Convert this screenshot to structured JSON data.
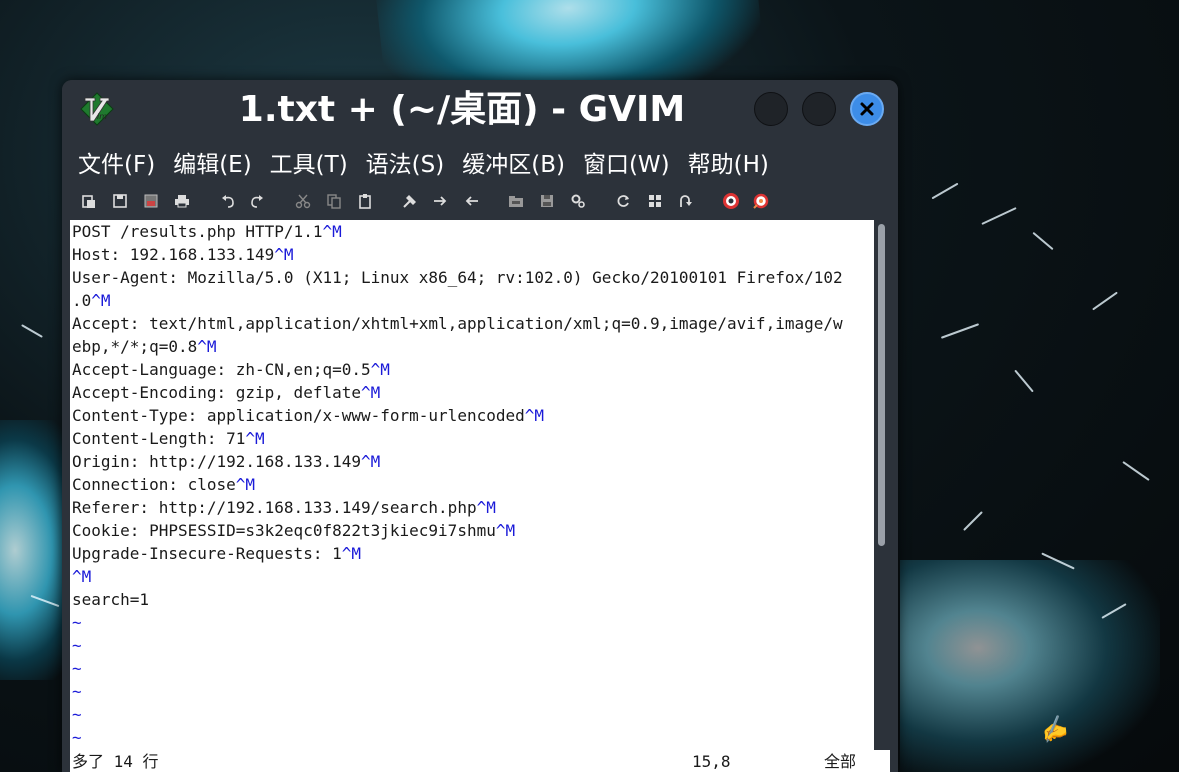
{
  "window": {
    "title": "1.txt + (~/桌面) - GVIM",
    "controls": [
      "minimize",
      "maximize",
      "close"
    ]
  },
  "menubar": {
    "items": [
      {
        "label": "文件(F)"
      },
      {
        "label": "编辑(E)"
      },
      {
        "label": "工具(T)"
      },
      {
        "label": "语法(S)"
      },
      {
        "label": "缓冲区(B)"
      },
      {
        "label": "窗口(W)"
      },
      {
        "label": "帮助(H)"
      }
    ]
  },
  "toolbar": {
    "buttons": [
      {
        "icon": "open-file-icon"
      },
      {
        "icon": "save-icon"
      },
      {
        "icon": "save-all-icon"
      },
      {
        "icon": "print-icon"
      },
      {
        "icon": "undo-icon"
      },
      {
        "icon": "redo-icon"
      },
      {
        "icon": "cut-icon"
      },
      {
        "icon": "copy-icon"
      },
      {
        "icon": "paste-icon"
      },
      {
        "icon": "replace-icon"
      },
      {
        "icon": "find-next-icon"
      },
      {
        "icon": "find-previous-icon"
      },
      {
        "icon": "load-session-icon"
      },
      {
        "icon": "save-session-icon"
      },
      {
        "icon": "run-script-icon"
      },
      {
        "icon": "make-icon"
      },
      {
        "icon": "run-ctags-icon"
      },
      {
        "icon": "jump-tag-icon"
      },
      {
        "icon": "help-icon"
      },
      {
        "icon": "find-help-icon"
      }
    ]
  },
  "editor": {
    "lines": [
      {
        "text": "POST /results.php HTTP/1.1",
        "cr": "^M"
      },
      {
        "text": "Host: 192.168.133.149",
        "cr": "^M"
      },
      {
        "text": "User-Agent: Mozilla/5.0 (X11; Linux x86_64; rv:102.0) Gecko/20100101 Firefox/102",
        "cr": ""
      },
      {
        "text": ".0",
        "cr": "^M"
      },
      {
        "text": "Accept: text/html,application/xhtml+xml,application/xml;q=0.9,image/avif,image/w",
        "cr": ""
      },
      {
        "text": "ebp,*/*;q=0.8",
        "cr": "^M"
      },
      {
        "text": "Accept-Language: zh-CN,en;q=0.5",
        "cr": "^M"
      },
      {
        "text": "Accept-Encoding: gzip, deflate",
        "cr": "^M"
      },
      {
        "text": "Content-Type: application/x-www-form-urlencoded",
        "cr": "^M"
      },
      {
        "text": "Content-Length: 71",
        "cr": "^M"
      },
      {
        "text": "Origin: http://192.168.133.149",
        "cr": "^M"
      },
      {
        "text": "Connection: close",
        "cr": "^M"
      },
      {
        "text": "Referer: http://192.168.133.149/search.php",
        "cr": "^M"
      },
      {
        "text": "Cookie: PHPSESSID=s3k2eqc0f822t3jkiec9i7shmu",
        "cr": "^M"
      },
      {
        "text": "Upgrade-Insecure-Requests: 1",
        "cr": "^M"
      },
      {
        "text": "",
        "cr": "^M"
      },
      {
        "text": "search=1",
        "cr": ""
      }
    ],
    "filler": "~",
    "filler_count": 6
  },
  "status": {
    "message": "多了 14 行",
    "position": "15,8",
    "scroll": "全部"
  },
  "colors": {
    "window_bg": "#2c323a",
    "editor_bg": "#ffffff",
    "special_char": "#1a1ad8",
    "close_button": "#3d8de8"
  }
}
